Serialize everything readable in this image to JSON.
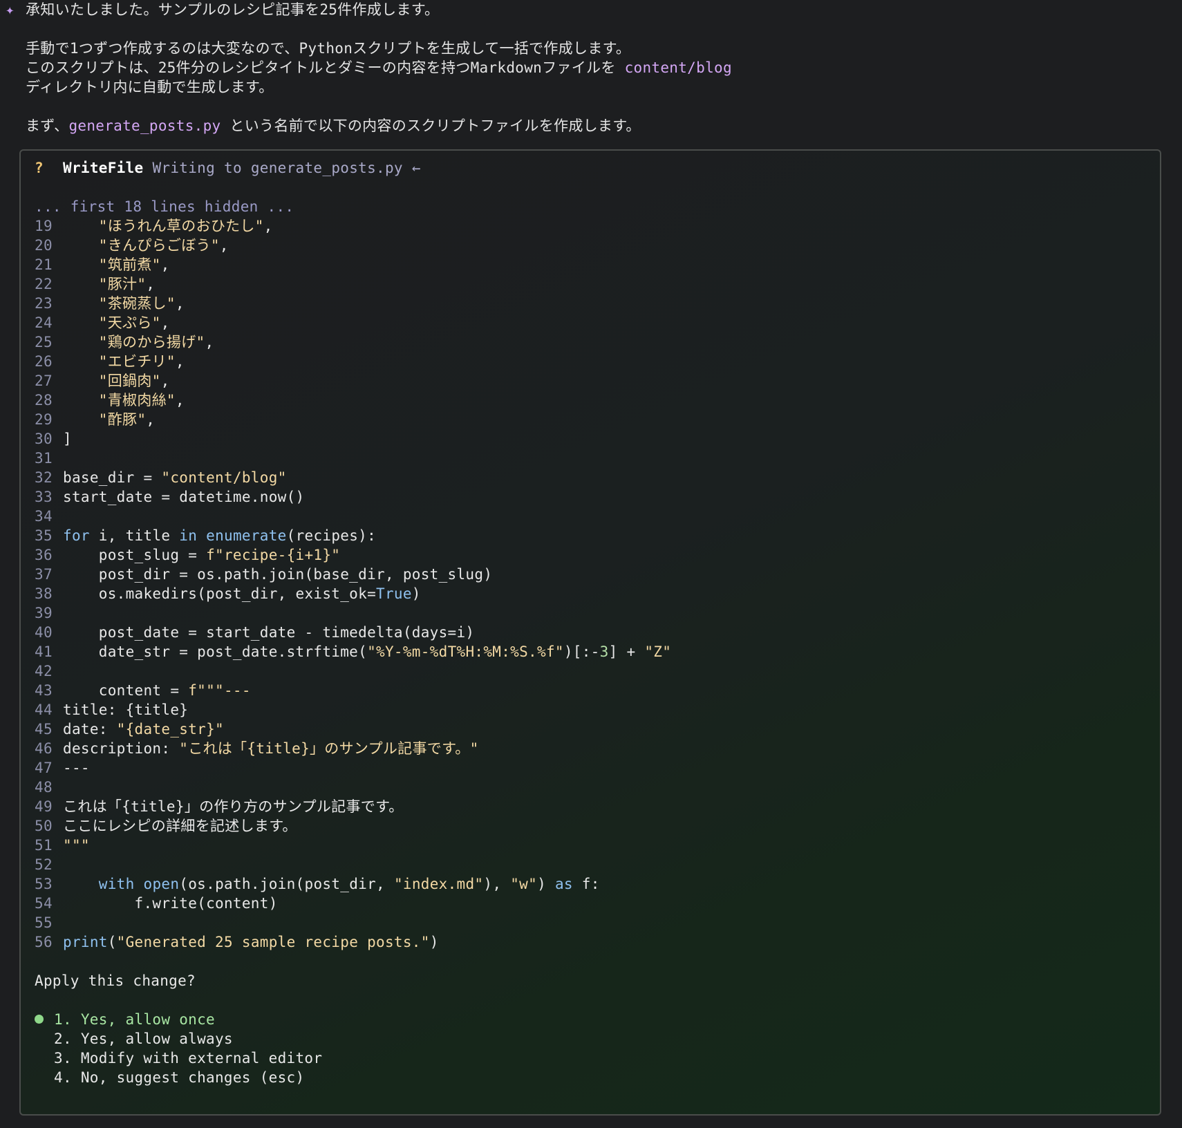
{
  "message": {
    "sparkle_icon": "✦",
    "line1": "承知いたしました。サンプルのレシピ記事を25件作成します。",
    "para1": "手動で1つずつ作成するのは大変なので、Pythonスクリプトを生成して一括で作成します。",
    "para2a": "このスクリプトは、25件分のレシピタイトルとダミーの内容を持つMarkdownファイルを ",
    "para2_path": "content/blog",
    "para3": "ディレクトリ内に自動で生成します。",
    "para4a": "まず、",
    "para4_file": "generate_posts.py",
    "para4b": " という名前で以下の内容のスクリプトファイルを作成します。"
  },
  "tool_call": {
    "status_icon": "?",
    "tool_name": "WriteFile",
    "description": "Writing to generate_posts.py",
    "arrow_icon": "←",
    "hidden_note": "... first 18 lines hidden ..."
  },
  "code_lines": [
    {
      "n": "19",
      "t": "    \"ほうれん草のおひたし\","
    },
    {
      "n": "20",
      "t": "    \"きんぴらごぼう\","
    },
    {
      "n": "21",
      "t": "    \"筑前煮\","
    },
    {
      "n": "22",
      "t": "    \"豚汁\","
    },
    {
      "n": "23",
      "t": "    \"茶碗蒸し\","
    },
    {
      "n": "24",
      "t": "    \"天ぷら\","
    },
    {
      "n": "25",
      "t": "    \"鶏のから揚げ\","
    },
    {
      "n": "26",
      "t": "    \"エビチリ\","
    },
    {
      "n": "27",
      "t": "    \"回鍋肉\","
    },
    {
      "n": "28",
      "t": "    \"青椒肉絲\","
    },
    {
      "n": "29",
      "t": "    \"酢豚\","
    },
    {
      "n": "30",
      "t": "]"
    },
    {
      "n": "31",
      "t": ""
    },
    {
      "n": "32",
      "t": "base_dir = \"content/blog\""
    },
    {
      "n": "33",
      "t": "start_date = datetime.now()"
    },
    {
      "n": "34",
      "t": ""
    },
    {
      "n": "35",
      "t": "for i, title in enumerate(recipes):"
    },
    {
      "n": "36",
      "t": "    post_slug = f\"recipe-{i+1}\""
    },
    {
      "n": "37",
      "t": "    post_dir = os.path.join(base_dir, post_slug)"
    },
    {
      "n": "38",
      "t": "    os.makedirs(post_dir, exist_ok=True)"
    },
    {
      "n": "39",
      "t": ""
    },
    {
      "n": "40",
      "t": "    post_date = start_date - timedelta(days=i)"
    },
    {
      "n": "41",
      "t": "    date_str = post_date.strftime(\"%Y-%m-%dT%H:%M:%S.%f\")[:-3] + \"Z\""
    },
    {
      "n": "42",
      "t": ""
    },
    {
      "n": "43",
      "t": "    content = f\"\"\"---"
    },
    {
      "n": "44",
      "t": "title: {title}"
    },
    {
      "n": "45",
      "t": "date: \"{date_str}\""
    },
    {
      "n": "46",
      "t": "description: \"これは「{title}」のサンプル記事です。\""
    },
    {
      "n": "47",
      "t": "---"
    },
    {
      "n": "48",
      "t": ""
    },
    {
      "n": "49",
      "t": "これは「{title}」の作り方のサンプル記事です。"
    },
    {
      "n": "50",
      "t": "ここにレシピの詳細を記述します。"
    },
    {
      "n": "51",
      "t": "\"\"\""
    },
    {
      "n": "52",
      "t": ""
    },
    {
      "n": "53",
      "t": "    with open(os.path.join(post_dir, \"index.md\"), \"w\") as f:"
    },
    {
      "n": "54",
      "t": "        f.write(content)"
    },
    {
      "n": "55",
      "t": ""
    },
    {
      "n": "56",
      "t": "print(\"Generated 25 sample recipe posts.\")"
    }
  ],
  "prompt": {
    "question": "Apply this change?",
    "options": [
      {
        "label": "1. Yes, allow once",
        "selected": true
      },
      {
        "label": "2. Yes, allow always",
        "selected": false
      },
      {
        "label": "3. Modify with external editor",
        "selected": false
      },
      {
        "label": "4. No, suggest changes (esc)",
        "selected": false
      }
    ]
  },
  "colors": {
    "background": "#1d1e20",
    "accent_purple": "#d4a7f5",
    "selected_green": "#a8e6a3",
    "string_yellow": "#f3d9a4",
    "keyword_blue": "#8fc1ef",
    "line_number": "#8c8fa8"
  }
}
